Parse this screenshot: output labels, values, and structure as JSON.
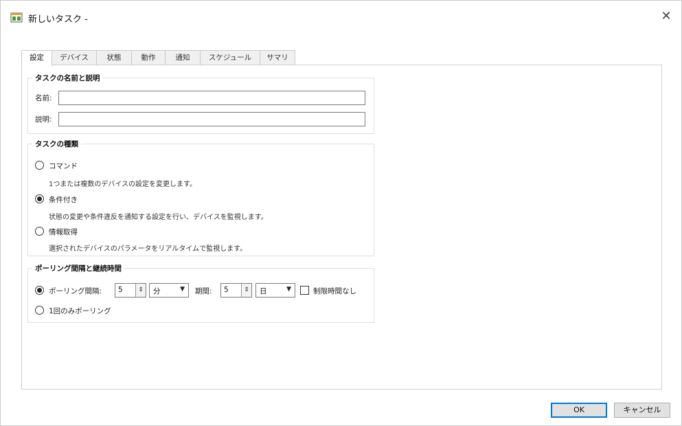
{
  "window": {
    "title": "新しいタスク -",
    "close_glyph": "✕"
  },
  "tabs": [
    "設定",
    "デバイス",
    "状態",
    "動作",
    "通知",
    "スケジュール",
    "サマリ"
  ],
  "active_tab": 0,
  "group_name": {
    "title": "タスクの名前と説明",
    "name_label": "名前:",
    "name_value": "",
    "desc_label": "説明:",
    "desc_value": ""
  },
  "group_type": {
    "title": "タスクの種類",
    "options": [
      {
        "label": "コマンド",
        "desc": "1つまたは複数のデバイスの設定を変更します。",
        "checked": false
      },
      {
        "label": "条件付き",
        "desc": "状態の変更や条件違反を通知する設定を行い、デバイスを監視します。",
        "checked": true
      },
      {
        "label": "情報取得",
        "desc": "選択されたデバイスのパラメータをリアルタイムで監視します。",
        "checked": false
      }
    ]
  },
  "group_polling": {
    "title": "ポーリング間隔と継続時間",
    "interval_label": "ポーリング間隔:",
    "interval_value": "5",
    "interval_unit": "分",
    "period_label": "期間:",
    "period_value": "5",
    "period_unit": "日",
    "no_limit_label": "制限時間なし",
    "no_limit_checked": false,
    "once_label": "1回のみポーリング",
    "interval_checked": true
  },
  "buttons": {
    "ok": "OK",
    "cancel": "キャンセル"
  },
  "colors": {
    "accent": "#0078d7",
    "tab_inactive": "#f0f0f0",
    "border": "#cfcfcf"
  }
}
